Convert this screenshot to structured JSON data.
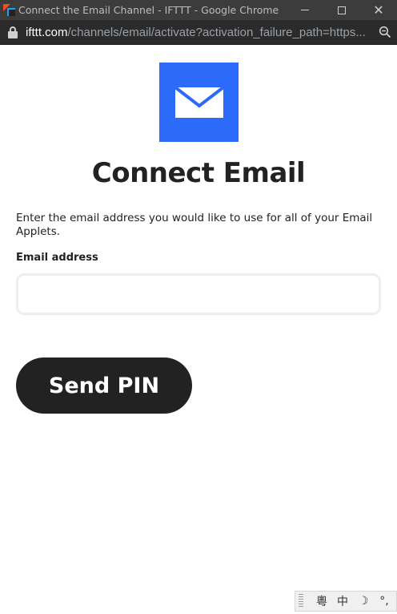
{
  "window": {
    "title": "Connect the Email Channel - IFTTT - Google Chrome"
  },
  "addressbar": {
    "url_host": "ifttt.com",
    "url_path": "/channels/email/activate?activation_failure_path=https..."
  },
  "page": {
    "heading": "Connect Email",
    "description": "Enter the email address you would like to use for all of your Email Applets.",
    "email_label": "Email address",
    "email_value": "",
    "email_placeholder": "",
    "send_button_label": "Send PIN",
    "brand_color": "#2c6bfa",
    "button_color": "#222222"
  },
  "ime": {
    "items": [
      "粵",
      "中",
      "☽",
      "°,"
    ]
  }
}
